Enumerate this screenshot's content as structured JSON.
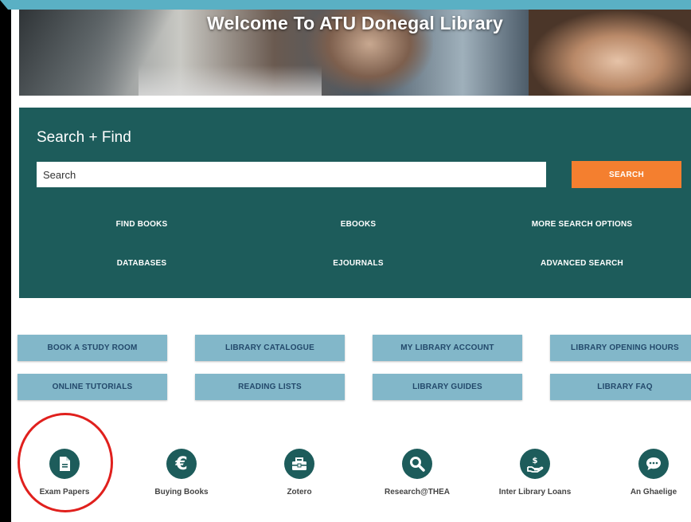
{
  "hero": {
    "title": "Welcome To ATU Donegal Library"
  },
  "search": {
    "heading": "Search + Find",
    "placeholder": "Search",
    "button_label": "SEARCH",
    "links": [
      "FIND BOOKS",
      "EBOOKS",
      "MORE SEARCH OPTIONS",
      "DATABASES",
      "EJOURNALS",
      "ADVANCED SEARCH"
    ]
  },
  "quick_links": [
    "BOOK A STUDY ROOM",
    "LIBRARY CATALOGUE",
    "MY LIBRARY ACCOUNT",
    "LIBRARY OPENING HOURS",
    "ONLINE TUTORIALS",
    "READING LISTS",
    "LIBRARY GUIDES",
    "LIBRARY FAQ"
  ],
  "icon_links": [
    {
      "label": "Exam Papers",
      "icon": "document-icon"
    },
    {
      "label": "Buying Books",
      "icon": "euro-icon"
    },
    {
      "label": "Zotero",
      "icon": "toolbox-icon"
    },
    {
      "label": "Research@THEA",
      "icon": "search-icon"
    },
    {
      "label": "Inter Library Loans",
      "icon": "hand-dollar-icon"
    },
    {
      "label": "An Ghaelige",
      "icon": "speech-bubble-icon"
    }
  ],
  "colors": {
    "panel": "#1d5c5b",
    "accent": "#f47f2f",
    "button": "#82b7c9",
    "highlight": "#e0201d",
    "background": "#5ab0c4"
  }
}
